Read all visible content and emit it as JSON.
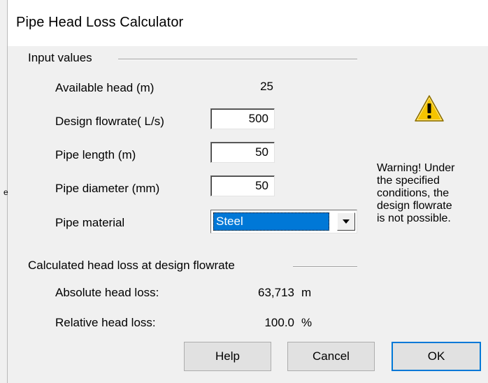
{
  "window": {
    "title": "Pipe Head Loss Calculator",
    "stray_mark": "e"
  },
  "input_group": {
    "label": "Input values",
    "available_head_label": "Available head (m)",
    "available_head_value": "25",
    "flowrate_label": "Design flowrate( L/s)",
    "flowrate_value": "500",
    "length_label": "Pipe length (m)",
    "length_value": "50",
    "diameter_label": "Pipe diameter (mm)",
    "diameter_value": "50",
    "material_label": "Pipe material",
    "material_value": "Steel"
  },
  "warning": {
    "icon": "warning-triangle-icon",
    "lines": [
      "Warning!  Under",
      "the specified",
      "conditions, the",
      "design flowrate",
      "is not possible."
    ]
  },
  "results_group": {
    "label": "Calculated head loss at design flowrate",
    "absolute_label": "Absolute head loss:",
    "absolute_value": "63,713",
    "absolute_unit": "m",
    "relative_label": "Relative head loss:",
    "relative_value": "100.0",
    "relative_unit": "%"
  },
  "buttons": {
    "help": "Help",
    "cancel": "Cancel",
    "ok": "OK"
  },
  "colors": {
    "selection": "#0078d7",
    "warning_yellow": "#f5c400"
  }
}
